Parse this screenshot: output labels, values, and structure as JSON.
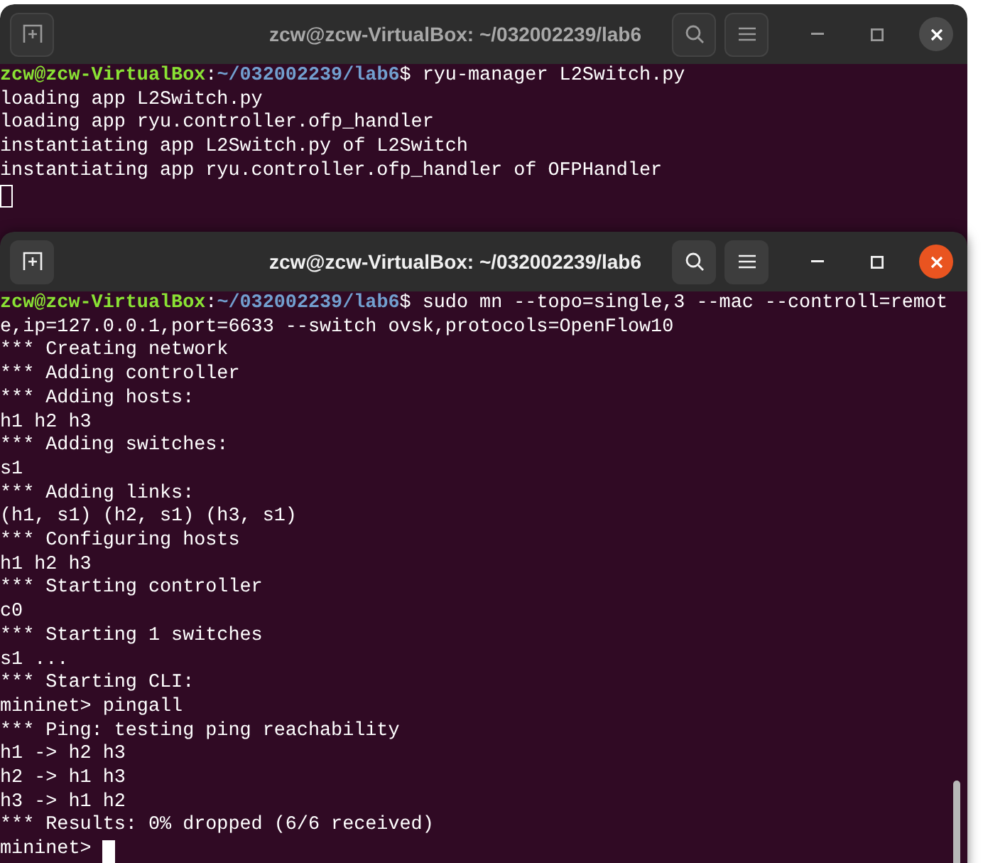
{
  "windows": [
    {
      "title": "zcw@zcw-VirtualBox: ~/032002239/lab6",
      "focused": false,
      "lines": [
        {
          "kind": "prompt",
          "user": "zcw@zcw-VirtualBox",
          "colon": ":",
          "path": "~/032002239/lab6",
          "command": "$ ryu-manager L2Switch.py"
        },
        {
          "kind": "output",
          "text": "loading app L2Switch.py"
        },
        {
          "kind": "output",
          "text": "loading app ryu.controller.ofp_handler"
        },
        {
          "kind": "output",
          "text": "instantiating app L2Switch.py of L2Switch"
        },
        {
          "kind": "output",
          "text": "instantiating app ryu.controller.ofp_handler of OFPHandler"
        },
        {
          "kind": "cursor"
        }
      ]
    },
    {
      "title": "zcw@zcw-VirtualBox: ~/032002239/lab6",
      "focused": true,
      "lines": [
        {
          "kind": "prompt",
          "user": "zcw@zcw-VirtualBox",
          "colon": ":",
          "path": "~/032002239/lab6",
          "command": "$ sudo mn --topo=single,3 --mac --controll=remote,ip=127.0.0.1,port=6633 --switch ovsk,protocols=OpenFlow10"
        },
        {
          "kind": "output",
          "text": "*** Creating network"
        },
        {
          "kind": "output",
          "text": "*** Adding controller"
        },
        {
          "kind": "output",
          "text": "*** Adding hosts:"
        },
        {
          "kind": "output",
          "text": "h1 h2 h3"
        },
        {
          "kind": "output",
          "text": "*** Adding switches:"
        },
        {
          "kind": "output",
          "text": "s1"
        },
        {
          "kind": "output",
          "text": "*** Adding links:"
        },
        {
          "kind": "output",
          "text": "(h1, s1) (h2, s1) (h3, s1)"
        },
        {
          "kind": "output",
          "text": "*** Configuring hosts"
        },
        {
          "kind": "output",
          "text": "h1 h2 h3"
        },
        {
          "kind": "output",
          "text": "*** Starting controller"
        },
        {
          "kind": "output",
          "text": "c0"
        },
        {
          "kind": "output",
          "text": "*** Starting 1 switches"
        },
        {
          "kind": "output",
          "text": "s1 ..."
        },
        {
          "kind": "output",
          "text": "*** Starting CLI:"
        },
        {
          "kind": "output",
          "text": "mininet> pingall"
        },
        {
          "kind": "output",
          "text": "*** Ping: testing ping reachability"
        },
        {
          "kind": "output",
          "text": "h1 -> h2 h3"
        },
        {
          "kind": "output",
          "text": "h2 -> h1 h3"
        },
        {
          "kind": "output",
          "text": "h3 -> h1 h2"
        },
        {
          "kind": "output",
          "text": "*** Results: 0% dropped (6/6 received)"
        },
        {
          "kind": "cursor",
          "text": "mininet>"
        }
      ]
    }
  ]
}
